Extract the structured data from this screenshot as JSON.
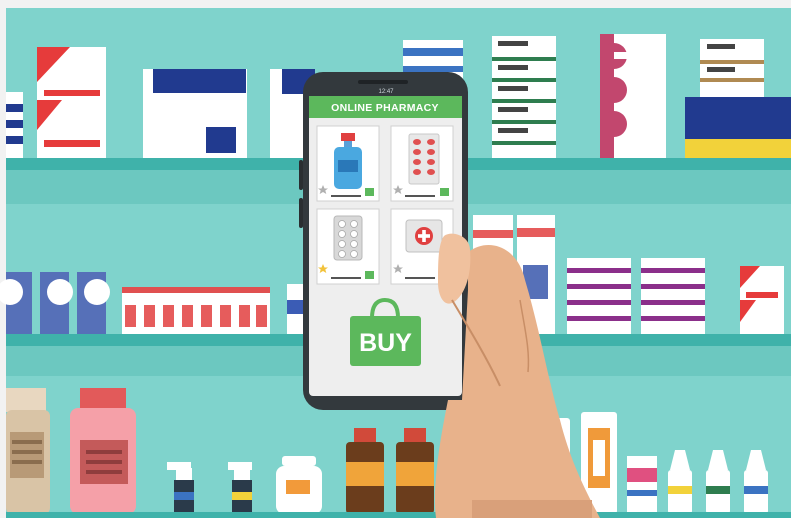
{
  "scene": {
    "theme": "online pharmacy illustration",
    "colors": {
      "wall": "#7fd3cc",
      "shelf": "#3fb2aa",
      "accent_green": "#5cb85c",
      "phone_body": "#33393d",
      "screen": "#eeeeee",
      "skin": "#e8b28b"
    }
  },
  "phone": {
    "status_time": "12:47",
    "app_title": "ONLINE PHARMACY",
    "buy_label": "BUY",
    "products": [
      {
        "icon": "bottle-icon"
      },
      {
        "icon": "pill-strip-icon"
      },
      {
        "icon": "pill-pack-icon"
      },
      {
        "icon": "first-aid-box-icon"
      }
    ]
  }
}
